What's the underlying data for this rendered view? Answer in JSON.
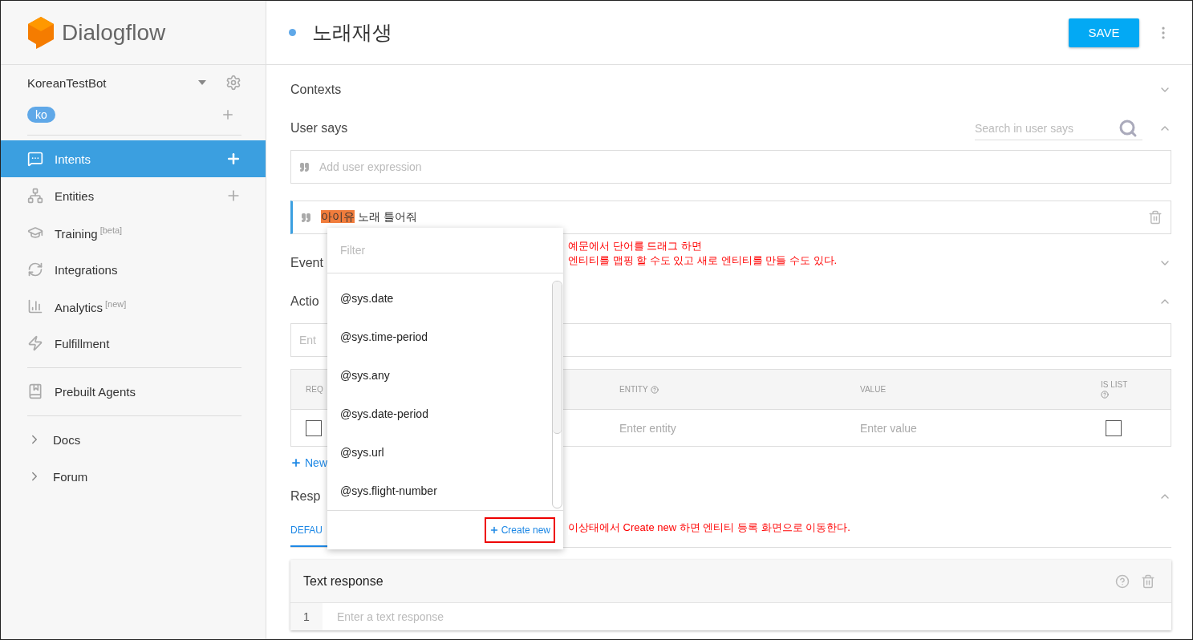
{
  "sidebar": {
    "logo": "Dialogflow",
    "agent": "KoreanTestBot",
    "language": "ko",
    "groups": [
      {
        "items": [
          {
            "kind": "nav",
            "label": "Intents",
            "selected": true,
            "addable": true
          },
          {
            "kind": "nav",
            "label": "Entities",
            "selected": false,
            "addable": true
          },
          {
            "kind": "nav",
            "label": "Training",
            "tag": "[beta]",
            "selected": false,
            "addable": false
          },
          {
            "kind": "nav",
            "label": "Integrations",
            "selected": false,
            "addable": false
          },
          {
            "kind": "nav",
            "label": "Analytics",
            "tag": "[new]",
            "selected": false,
            "addable": false
          },
          {
            "kind": "nav",
            "label": "Fulfillment",
            "selected": false,
            "addable": false
          }
        ]
      },
      {
        "items": [
          {
            "kind": "nav",
            "label": "Prebuilt Agents",
            "selected": false,
            "addable": false
          }
        ]
      },
      {
        "items": [
          {
            "kind": "link",
            "label": "Docs",
            "selected": false,
            "addable": false
          },
          {
            "kind": "link",
            "label": "Forum",
            "selected": false,
            "addable": false
          }
        ]
      }
    ]
  },
  "intent": {
    "title": "노래재생",
    "save": "SAVE"
  },
  "contexts": {
    "title": "Contexts",
    "expanded": false
  },
  "user_says": {
    "title": "User says",
    "expanded": true,
    "search_placeholder": "Search in user says",
    "add_placeholder": "Add user expression",
    "expressions": [
      {
        "entity": "아이유",
        "text": "노래 틀어줘"
      }
    ]
  },
  "events": {
    "title": "Event",
    "expanded": false
  },
  "action": {
    "title": "Actio",
    "expanded": true,
    "placeholder": "Ent",
    "columns": [
      "REQ",
      "ENTITY",
      "VALUE",
      "IS LIST"
    ],
    "rows": [
      {
        "required": false,
        "entity_placeholder": "Enter entity",
        "value_placeholder": "Enter value",
        "is_list": false
      }
    ],
    "new_parameter": "New"
  },
  "responses": {
    "title": "Resp",
    "expanded": true,
    "tabs": [
      {
        "label": "DEFAU",
        "selected": true
      }
    ],
    "card_title": "Text response",
    "lines": [
      {
        "number": "1",
        "placeholder": "Enter a text response"
      }
    ]
  },
  "entity_menu": {
    "filter_placeholder": "Filter",
    "options": [
      "@sys.date",
      "@sys.time-period",
      "@sys.any",
      "@sys.date-period",
      "@sys.url",
      "@sys.flight-number"
    ],
    "create": "Create new"
  },
  "annotations": [
    "예문에서 단어를 드래그 하면\n엔티티를 맵핑 할 수도 있고 새로 엔티티를 만들 수도 있다.",
    "이상태에서 Create new 하면 엔티티 등록 화면으로 이동한다."
  ]
}
